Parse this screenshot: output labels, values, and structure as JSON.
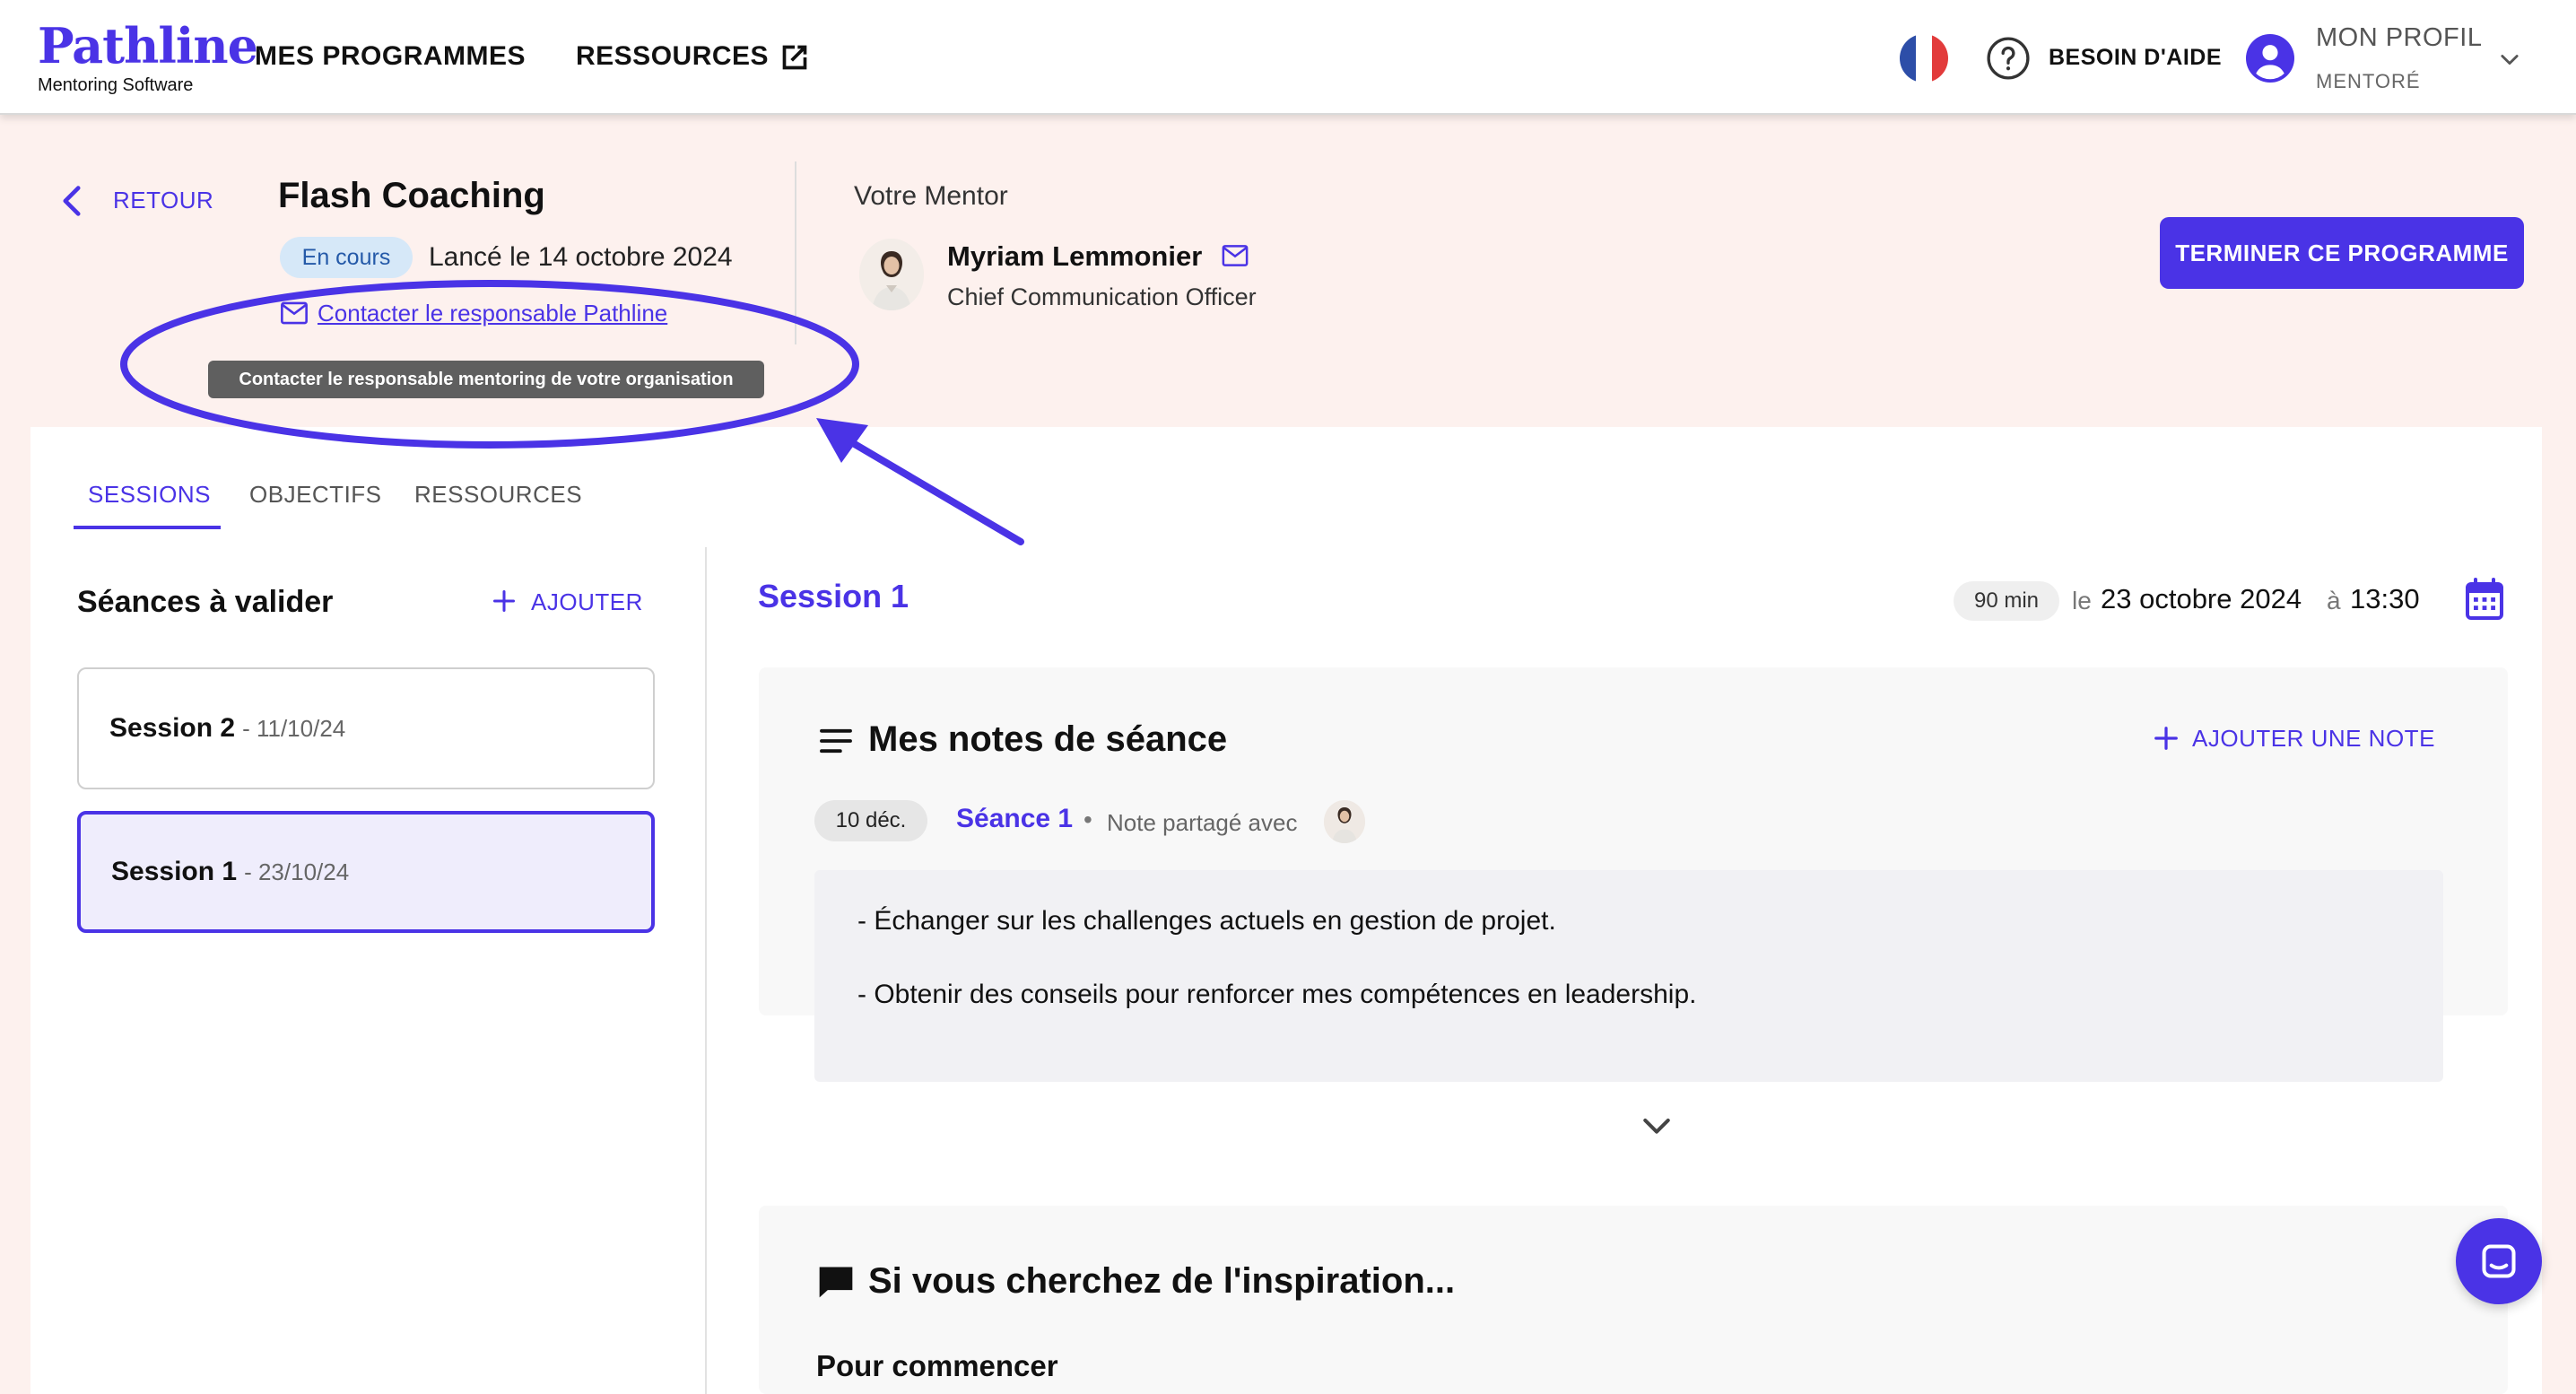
{
  "header": {
    "logo_name": "Pathline",
    "logo_sub": "Mentoring Software",
    "nav": [
      "MES PROGRAMMES",
      "RESSOURCES"
    ],
    "help_label": "BESOIN D'AIDE",
    "profile_title": "MON PROFIL",
    "profile_role": "MENTORÉ",
    "icons": [
      "external-link-icon",
      "france-flag-icon",
      "help-circle-icon",
      "user-circle-icon",
      "chevron-down-icon"
    ]
  },
  "program": {
    "back_label": "RETOUR",
    "title": "Flash Coaching",
    "status": "En cours",
    "launch_text": "Lancé le 14 octobre 2024",
    "contact_link": "Contacter le responsable Pathline",
    "tooltip": "Contacter le responsable mentoring de votre organisation",
    "end_button": "TERMINER CE PROGRAMME"
  },
  "mentor": {
    "label": "Votre Mentor",
    "name": "Myriam Lemmonier",
    "role": "Chief Communication Officer"
  },
  "tabs": [
    {
      "label": "SESSIONS",
      "active": true
    },
    {
      "label": "OBJECTIFS",
      "active": false
    },
    {
      "label": "RESSOURCES",
      "active": false
    }
  ],
  "sessions_panel": {
    "heading": "Séances à valider",
    "add_label": "AJOUTER",
    "items": [
      {
        "name": "Session 2",
        "date": "- 11/10/24",
        "selected": false
      },
      {
        "name": "Session 1",
        "date": "- 23/10/24",
        "selected": true
      }
    ]
  },
  "session_detail": {
    "title": "Session 1",
    "duration": "90 min",
    "le": "le",
    "date": "23 octobre 2024",
    "a": "à",
    "time": "13:30"
  },
  "notes": {
    "title": "Mes notes de séance",
    "add_label": "AJOUTER UNE NOTE",
    "note_date": "10 déc.",
    "note_session": "Séance 1",
    "bullet": "•",
    "shared_text": "Note partagé avec",
    "lines": [
      "- Échanger sur les challenges actuels en gestion de projet.",
      "- Obtenir des conseils pour renforcer mes compétences en leadership."
    ]
  },
  "inspiration": {
    "title": "Si vous cherchez de l'inspiration...",
    "subtitle": "Pour commencer"
  },
  "colors": {
    "accent": "#4a33e6",
    "page_bg": "#fdf1ee",
    "badge_bg": "#d6e8f8",
    "selected_bg": "#efedfc"
  }
}
